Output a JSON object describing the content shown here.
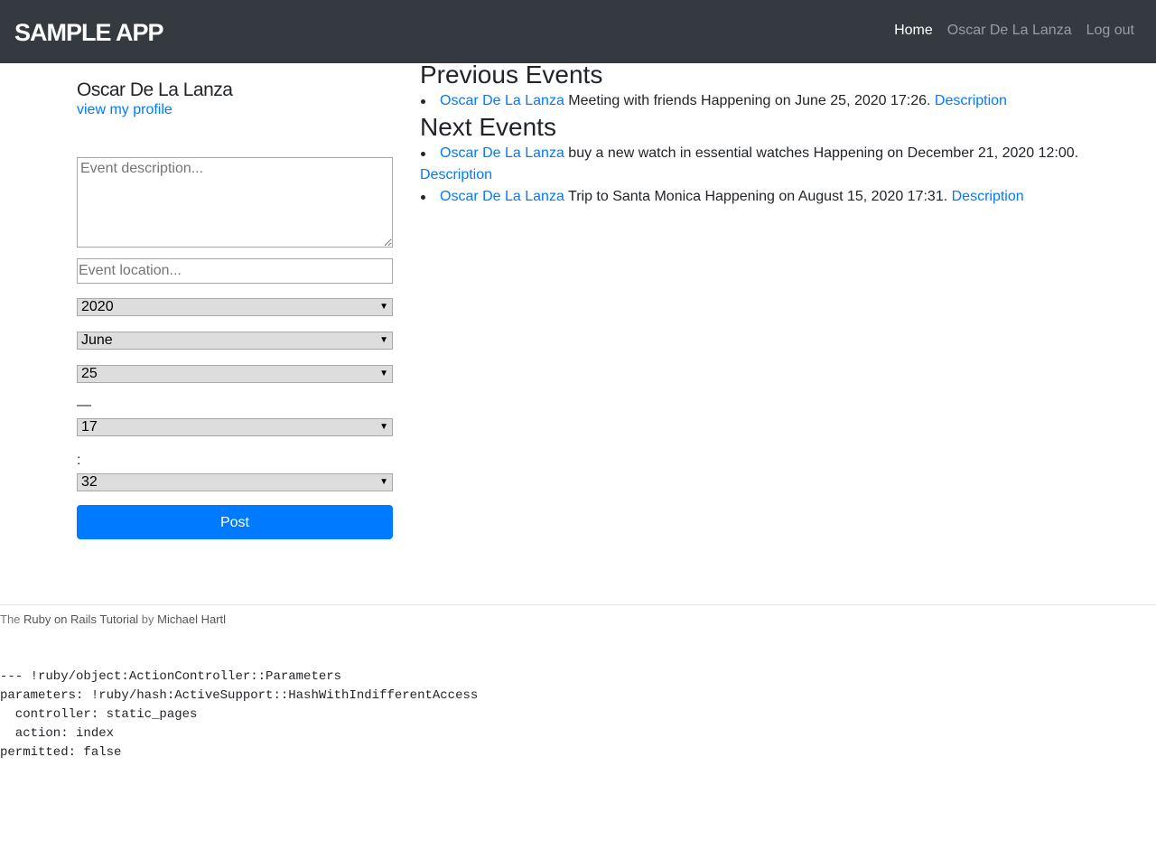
{
  "header": {
    "brand": "SAMPLE APP",
    "nav": [
      {
        "label": "Home",
        "active": true
      },
      {
        "label": "Oscar De La Lanza",
        "active": false
      },
      {
        "label": "Log out",
        "active": false
      }
    ]
  },
  "sidebar": {
    "user_name": "Oscar De La Lanza",
    "profile_link": "view my profile"
  },
  "form": {
    "description_placeholder": "Event description...",
    "location_placeholder": "Event location...",
    "year": "2020",
    "month": "June",
    "day": "25",
    "time_separator": "—",
    "hour": "17",
    "minute_separator": ":",
    "minute": "32",
    "submit_label": "Post"
  },
  "events": {
    "previous_title": "Previous Events",
    "previous": [
      {
        "author": "Oscar De La Lanza",
        "text": " Meeting with friends Happening on June 25, 2020 17:26. ",
        "link": "Description"
      }
    ],
    "next_title": "Next Events",
    "next": [
      {
        "author": "Oscar De La Lanza",
        "text": " buy a new watch in essential watches Happening on December 21, 2020 12:00.",
        "link": "Description"
      },
      {
        "author": "Oscar De La Lanza",
        "text": " Trip to Santa Monica Happening on August 15, 2020 17:31. ",
        "link": "Description"
      }
    ]
  },
  "footer": {
    "prefix": "The ",
    "tutorial_link": "Ruby on Rails Tutorial",
    "by": " by ",
    "author_link": "Michael Hartl"
  },
  "debug": {
    "lines": [
      "--- !ruby/object:ActionController::Parameters",
      "parameters: !ruby/hash:ActiveSupport::HashWithIndifferentAccess",
      "  controller: static_pages",
      "  action: index",
      "permitted: false"
    ]
  },
  "colors": {
    "navbar": "#343a40",
    "link": "#007bff",
    "button": "#007bff"
  }
}
